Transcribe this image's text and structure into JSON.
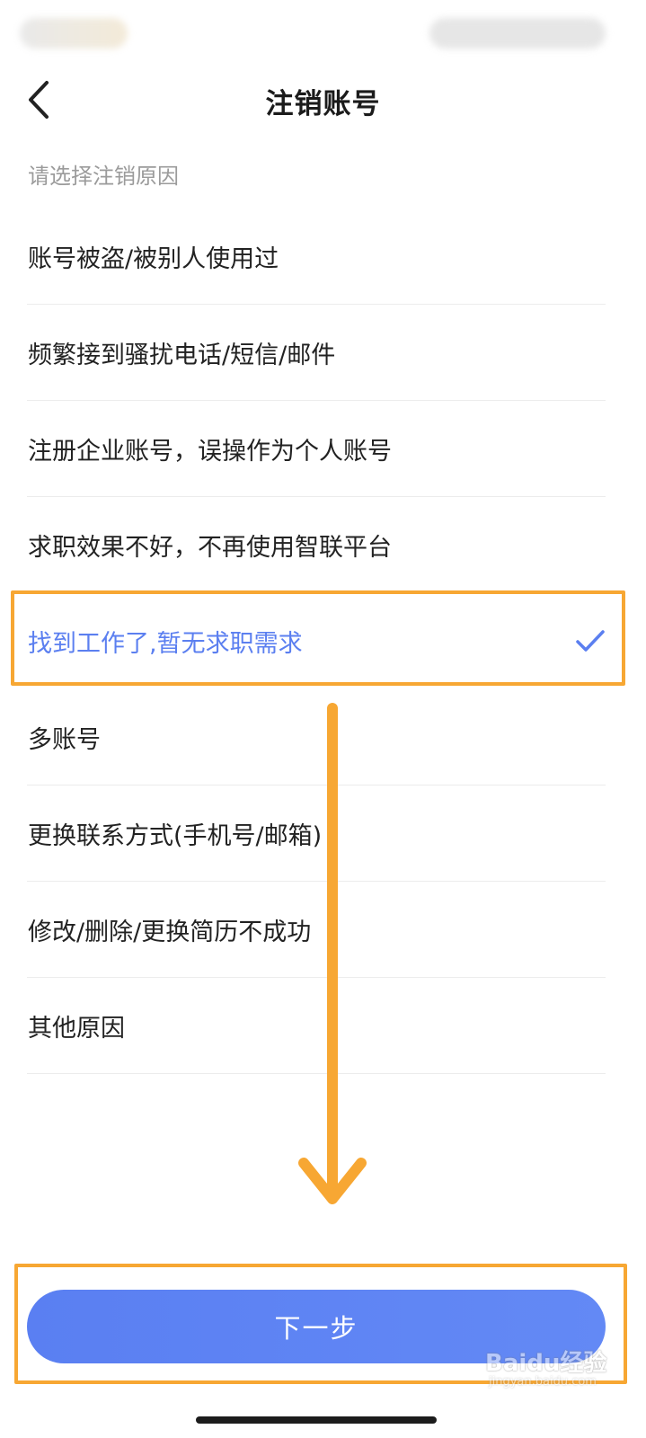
{
  "header": {
    "title": "注销账号"
  },
  "section_hint": "请选择注销原因",
  "reasons": [
    {
      "label": "账号被盗/被别人使用过",
      "selected": false
    },
    {
      "label": "频繁接到骚扰电话/短信/邮件",
      "selected": false
    },
    {
      "label": "注册企业账号，误操作为个人账号",
      "selected": false
    },
    {
      "label": "求职效果不好，不再使用智联平台",
      "selected": false
    },
    {
      "label": "找到工作了,暂无求职需求",
      "selected": true
    },
    {
      "label": "多账号",
      "selected": false
    },
    {
      "label": "更换联系方式(手机号/邮箱)",
      "selected": false
    },
    {
      "label": "修改/删除/更换简历不成功",
      "selected": false
    },
    {
      "label": "其他原因",
      "selected": false
    }
  ],
  "next_button": {
    "label": "下一步"
  },
  "watermark": {
    "brand": "Baidu经验",
    "url": "jingyan.baidu.com"
  },
  "icons": {
    "back": "chevron-left-icon",
    "check": "checkmark-icon"
  },
  "colors": {
    "accent": "#5b7ff0",
    "annotation": "#f7a733",
    "button": "#5a7ff2"
  }
}
